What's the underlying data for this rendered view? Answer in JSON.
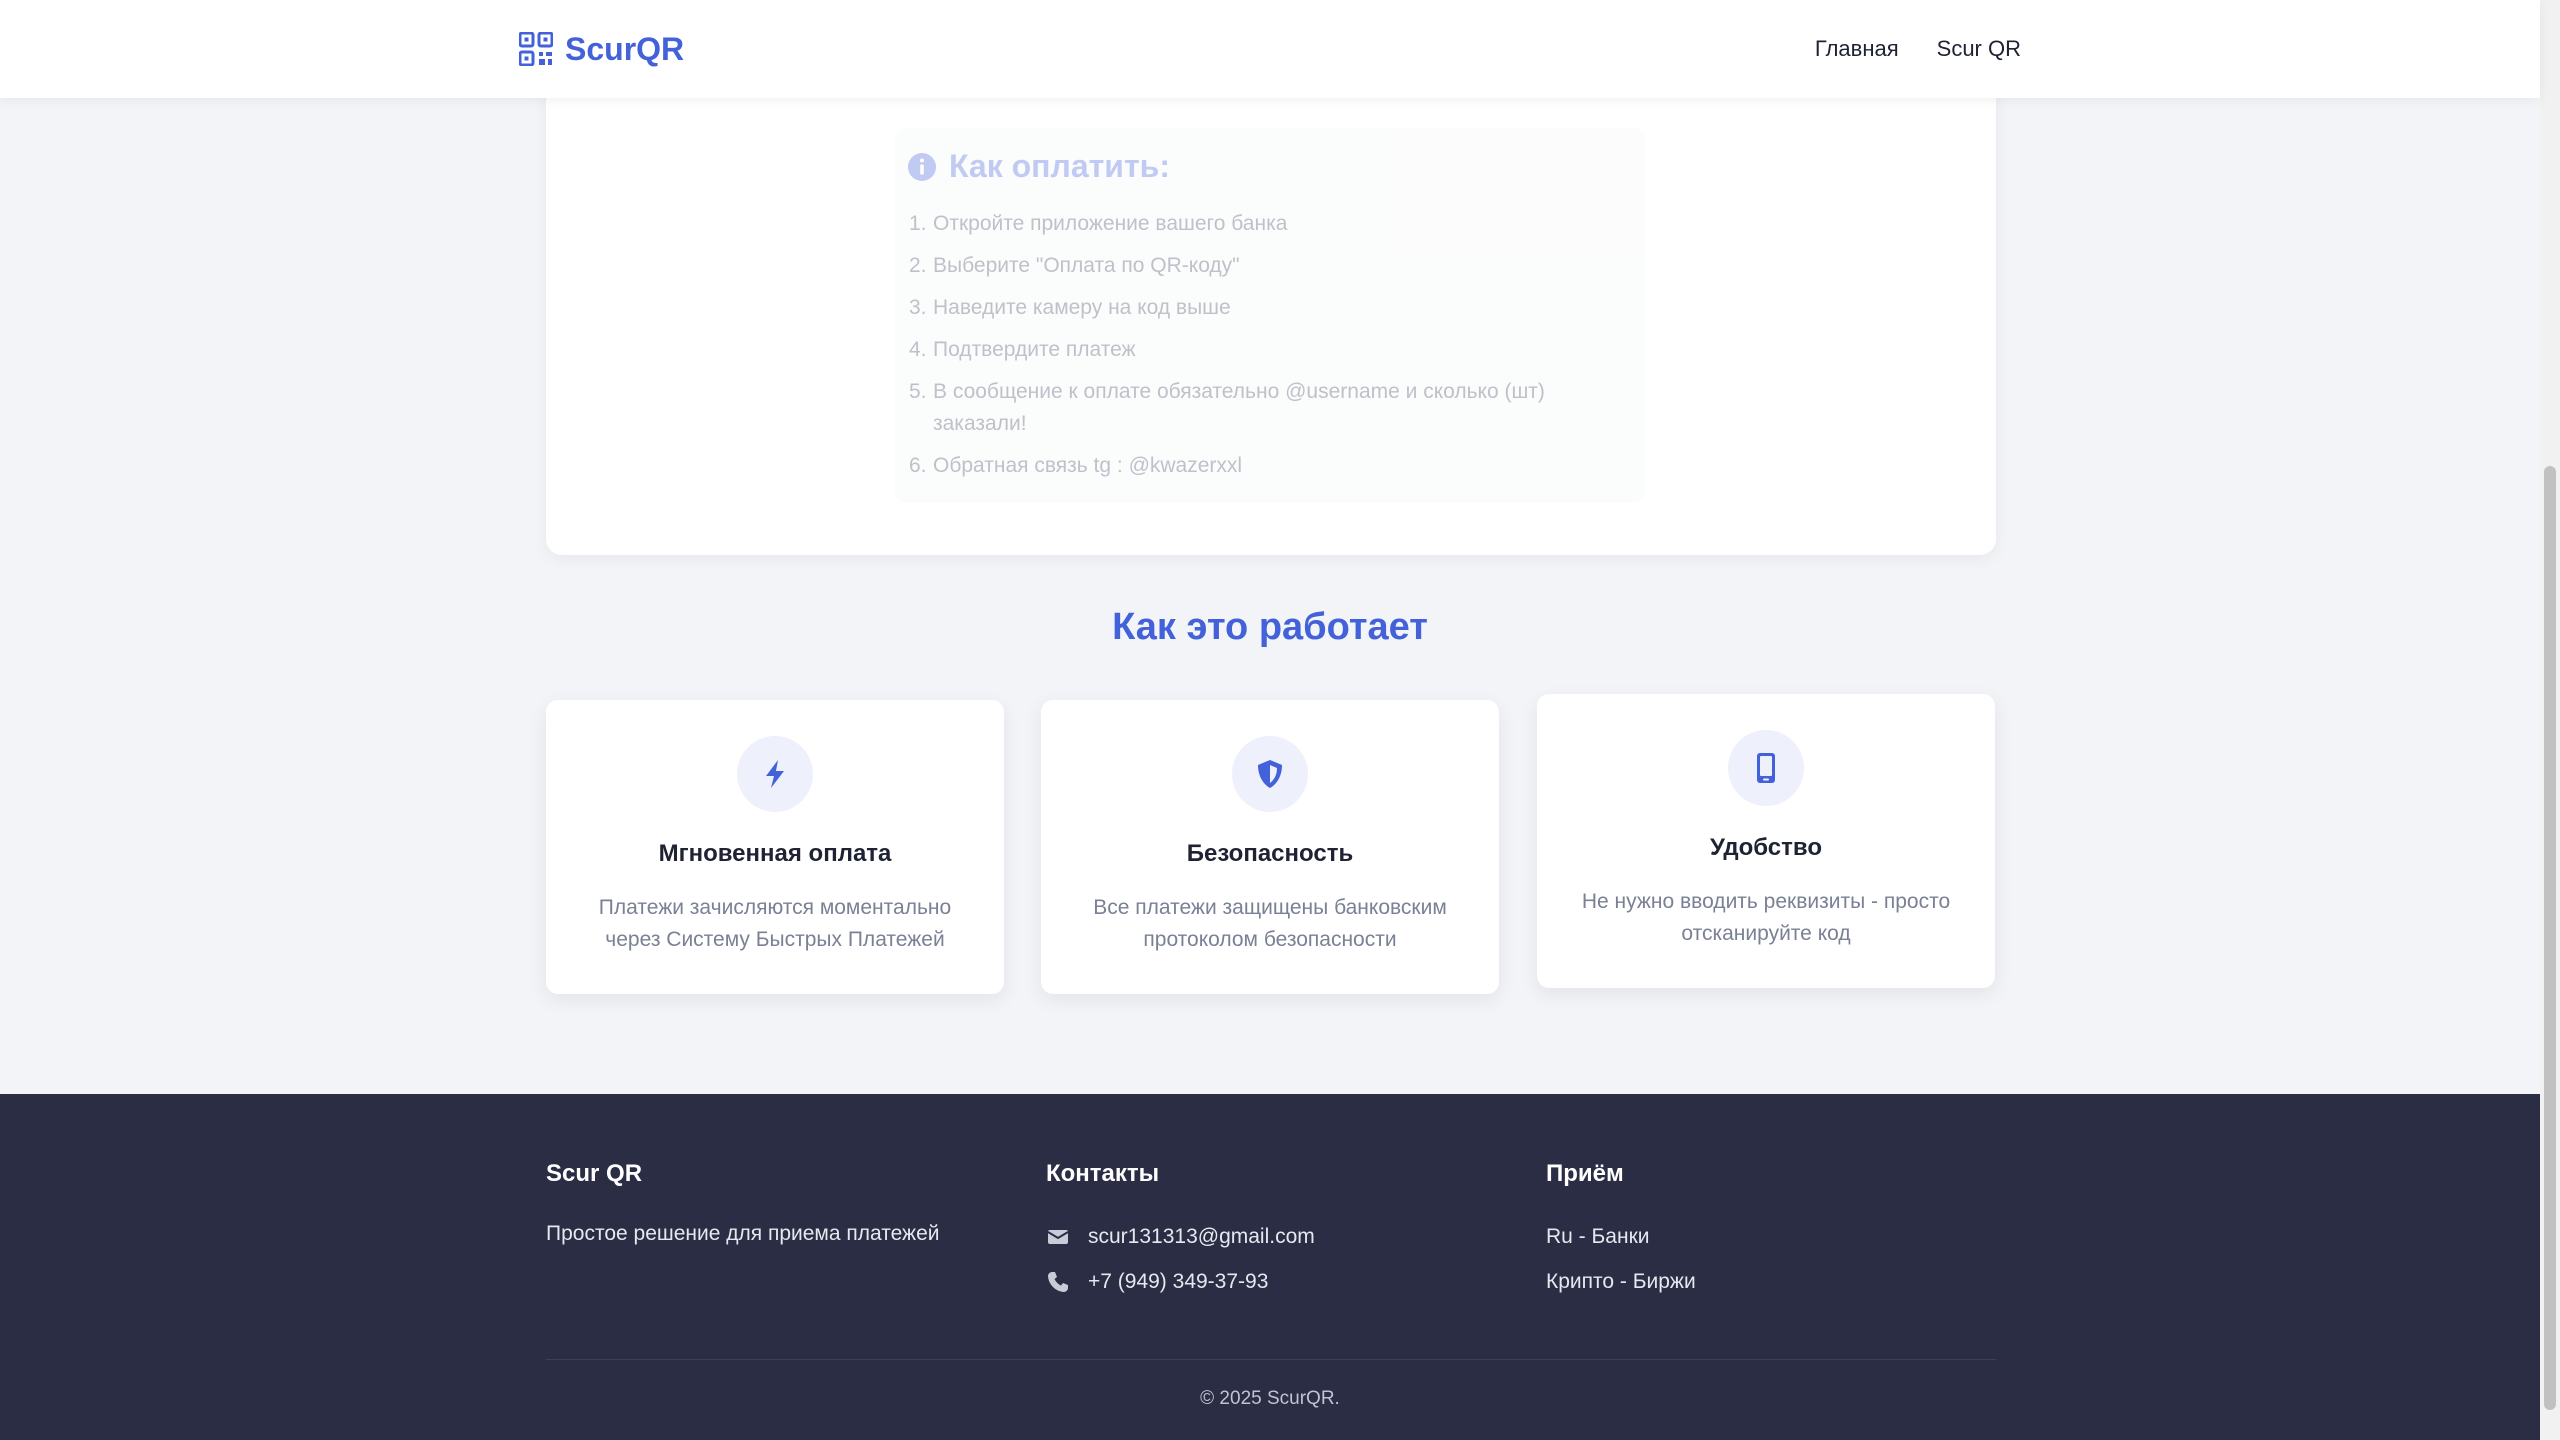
{
  "header": {
    "logo_text": "ScurQR",
    "logo_icon": "qrcode-icon",
    "nav": [
      {
        "label": "Главная"
      },
      {
        "label": "Scur QR"
      }
    ]
  },
  "howto": {
    "title": "Как оплатить:",
    "icon": "info-circle-icon",
    "steps": [
      {
        "num": "1.",
        "text": "Откройте приложение вашего банка"
      },
      {
        "num": "2.",
        "text": "Выберите \"Оплата по QR-коду\""
      },
      {
        "num": "3.",
        "text": "Наведите камеру на код выше"
      },
      {
        "num": "4.",
        "text": "Подтвердите платеж"
      },
      {
        "num": "5.",
        "text": "В сообщение к оплате обязательно @username и сколько (шт) заказали!"
      },
      {
        "num": "6.",
        "text": "Обратная связь tg : @kwazerxxl"
      }
    ]
  },
  "features": {
    "title": "Как это работает",
    "items": [
      {
        "icon": "bolt-icon",
        "title": "Мгновенная оплата",
        "desc": "Платежи зачисляются моментально через Систему Быстрых Платежей"
      },
      {
        "icon": "shield-icon",
        "title": "Безопасность",
        "desc": "Все платежи защищены банковским протоколом безопасности"
      },
      {
        "icon": "mobile-icon",
        "title": "Удобство",
        "desc": "Не нужно вводить реквизиты - просто отсканируйте код"
      }
    ]
  },
  "footer": {
    "col1": {
      "title": "Scur QR",
      "text": "Простое решение для приема платежей"
    },
    "col2": {
      "title": "Контакты",
      "email": "scur131313@gmail.com",
      "phone": "+7 (949) 349-37-93"
    },
    "col3": {
      "title": "Приём",
      "items": [
        "Ru - Банки",
        "Крипто - Биржи"
      ]
    },
    "copyright": "© 2025 ScurQR."
  },
  "colors": {
    "accent": "#4361d8",
    "footer_bg": "#2a2d43",
    "page_bg": "#f3f4f8"
  }
}
